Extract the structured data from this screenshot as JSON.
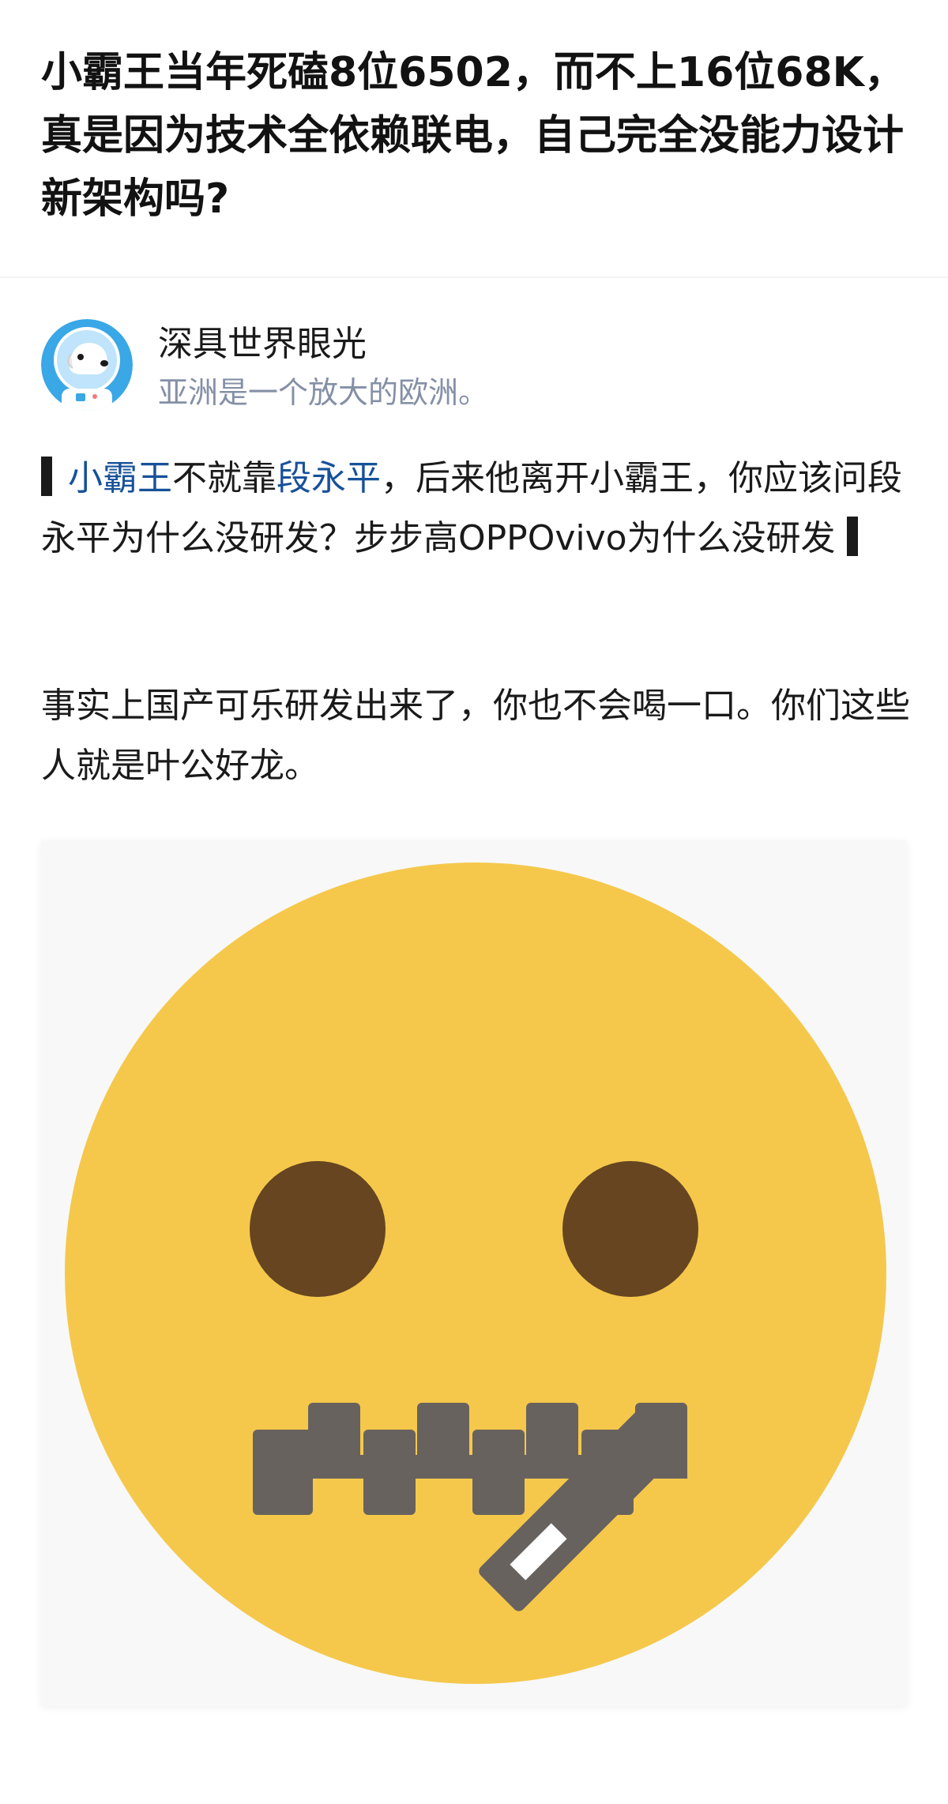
{
  "question": {
    "title": "小霸王当年死磕8位6502，而不上16位68K，真是因为技术全依赖联电，自己完全没能力设计新架构吗?"
  },
  "answer": {
    "author": {
      "name": "深具世界眼光",
      "bio": "亚洲是一个放大的欧洲。",
      "avatar_icon": "dog-astronaut-avatar-icon"
    },
    "quote": {
      "link1": "小霸王",
      "text1": "不就靠",
      "link2": "段永平",
      "text2": "，后来他离开小霸王，你应该问段永平为什么没研发？步步高OPPOvivo为什么没研发"
    },
    "paragraph": "事实上国产可乐研发出来了，你也不会喝一口。你们这些人就是叶公好龙。",
    "image": {
      "icon": "zipper-mouth-face-icon"
    }
  },
  "colors": {
    "link": "#175199",
    "muted": "#8590a6",
    "emoji_face": "#f5c84c",
    "emoji_eyes": "#664520",
    "emoji_zipper": "#68625f",
    "avatar_bg": "#3aa7e6"
  }
}
